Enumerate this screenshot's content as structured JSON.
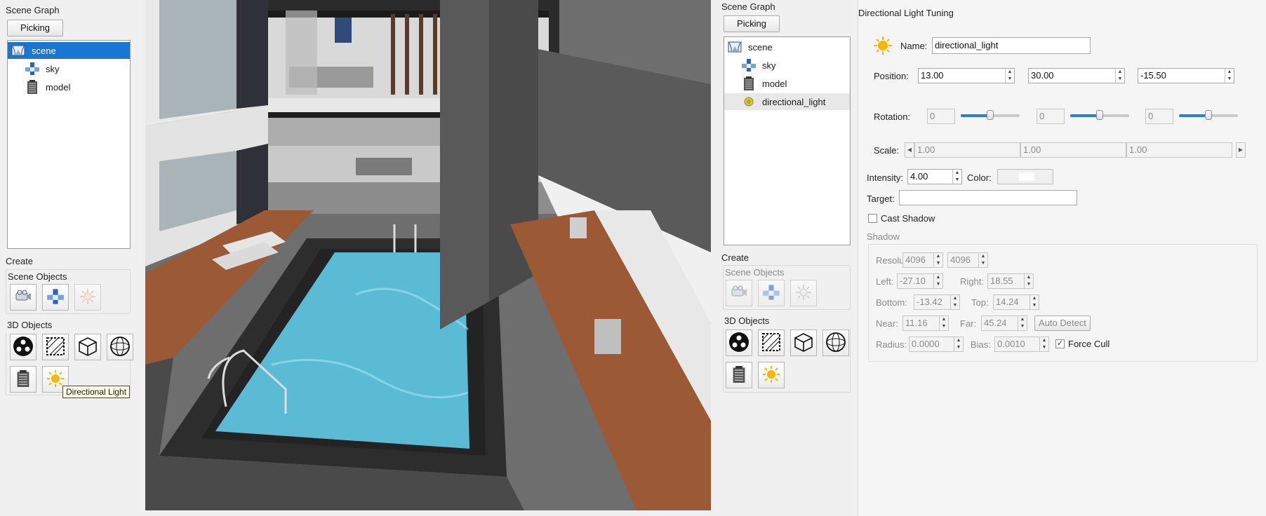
{
  "left_panel": {
    "title": "Scene Graph",
    "picking_label": "Picking",
    "tree": [
      {
        "label": "scene",
        "icon": "scene-icon",
        "selected": true
      },
      {
        "label": "sky",
        "icon": "sky-icon"
      },
      {
        "label": "model",
        "icon": "model-icon"
      }
    ],
    "create_label": "Create",
    "scene_objects_label": "Scene Objects",
    "objects_3d_label": "3D Objects",
    "tooltip": "Directional Light"
  },
  "right_tree_panel": {
    "title": "Scene Graph",
    "picking_label": "Picking",
    "tree": [
      {
        "label": "scene",
        "icon": "scene-icon"
      },
      {
        "label": "sky",
        "icon": "sky-icon"
      },
      {
        "label": "model",
        "icon": "model-icon"
      },
      {
        "label": "directional_light",
        "icon": "directional-light-icon",
        "hover": true
      }
    ],
    "create_label": "Create",
    "scene_objects_label": "Scene Objects",
    "objects_3d_label": "3D Objects"
  },
  "tuning": {
    "title": "Directional Light Tuning",
    "name_label": "Name:",
    "name_value": "directional_light",
    "position_label": "Position:",
    "position": [
      "13.00",
      "30.00",
      "-15.50"
    ],
    "rotation_label": "Rotation:",
    "rotation": [
      {
        "value": "0",
        "level": 0.5
      },
      {
        "value": "0",
        "level": 0.5
      },
      {
        "value": "0",
        "level": 0.5
      }
    ],
    "scale_label": "Scale:",
    "scale": [
      "1.00",
      "1.00",
      "1.00"
    ],
    "intensity_label": "Intensity:",
    "intensity_value": "4.00",
    "color_label": "Color:",
    "target_label": "Target:",
    "target_value": "",
    "cast_shadow_label": "Cast Shadow",
    "cast_shadow_checked": false,
    "shadow_group_label": "Shadow",
    "resolution_label": "Resolution:",
    "resolution": [
      "4096",
      "4096"
    ],
    "left_label": "Left:",
    "left_value": "-27.10",
    "right_label": "Right:",
    "right_value": "18.55",
    "bottom_label": "Bottom:",
    "bottom_value": "-13.42",
    "top_label": "Top:",
    "top_value": "14.24",
    "near_label": "Near:",
    "near_value": "11.16",
    "far_label": "Far:",
    "far_value": "45.24",
    "auto_detect_label": "Auto Detect",
    "radius_label": "Radius:",
    "radius_value": "0.0000",
    "bias_label": "Bias:",
    "bias_value": "0.0010",
    "force_cull_label": "Force Cull",
    "force_cull_checked": true
  },
  "colors": {
    "selection": "#1976d2",
    "slider_fill": "#2b7fd6",
    "pool_water": "#4fb3cf",
    "deck_wood": "#a0522d",
    "sun": "#f5b700"
  }
}
